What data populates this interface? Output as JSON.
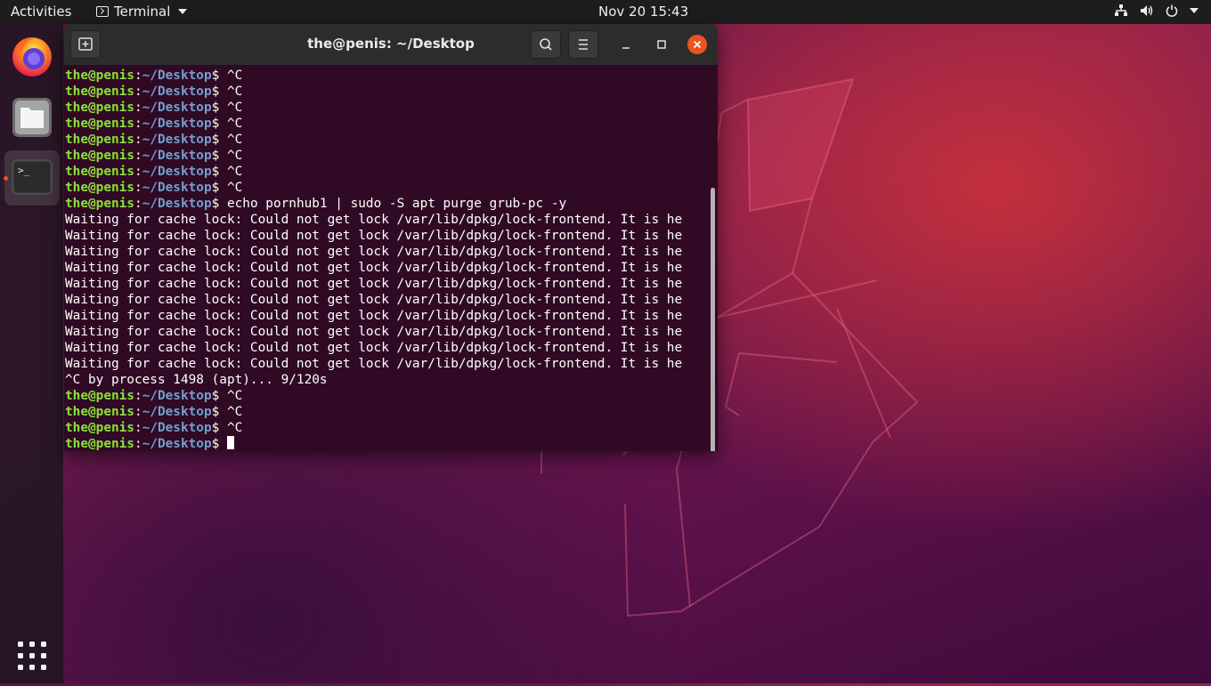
{
  "topbar": {
    "activities": "Activities",
    "app_name": "Terminal",
    "clock": "Nov 20  15:43",
    "tray_icons": [
      "network-icon",
      "volume-icon",
      "power-icon",
      "chevron-down-icon"
    ]
  },
  "dock": {
    "items": [
      {
        "name": "Firefox",
        "icon": "firefox-icon"
      },
      {
        "name": "Files",
        "icon": "files-icon"
      },
      {
        "name": "Terminal",
        "icon": "terminal-icon",
        "active": true,
        "running": true
      }
    ],
    "show_apps_icon": "grid-icon"
  },
  "window": {
    "title": "the@penis: ~/Desktop",
    "header_buttons": [
      "new-tab-icon",
      "search-icon",
      "hamburger-menu-icon",
      "minimize-icon",
      "maximize-icon",
      "close-icon"
    ]
  },
  "terminal": {
    "user_host": "the@penis",
    "path": "~/Desktop",
    "lines": [
      {
        "prompt": true,
        "cmd": "^C"
      },
      {
        "prompt": true,
        "cmd": "^C"
      },
      {
        "prompt": true,
        "cmd": "^C"
      },
      {
        "prompt": true,
        "cmd": "^C"
      },
      {
        "prompt": true,
        "cmd": "^C"
      },
      {
        "prompt": true,
        "cmd": "^C"
      },
      {
        "prompt": true,
        "cmd": "^C"
      },
      {
        "prompt": true,
        "cmd": "^C"
      },
      {
        "prompt": true,
        "cmd": "echo pornhub1 | sudo -S apt purge grub-pc -y"
      },
      {
        "prompt": false,
        "text": "Waiting for cache lock: Could not get lock /var/lib/dpkg/lock-frontend. It is he"
      },
      {
        "prompt": false,
        "text": "Waiting for cache lock: Could not get lock /var/lib/dpkg/lock-frontend. It is he"
      },
      {
        "prompt": false,
        "text": "Waiting for cache lock: Could not get lock /var/lib/dpkg/lock-frontend. It is he"
      },
      {
        "prompt": false,
        "text": "Waiting for cache lock: Could not get lock /var/lib/dpkg/lock-frontend. It is he"
      },
      {
        "prompt": false,
        "text": "Waiting for cache lock: Could not get lock /var/lib/dpkg/lock-frontend. It is he"
      },
      {
        "prompt": false,
        "text": "Waiting for cache lock: Could not get lock /var/lib/dpkg/lock-frontend. It is he"
      },
      {
        "prompt": false,
        "text": "Waiting for cache lock: Could not get lock /var/lib/dpkg/lock-frontend. It is he"
      },
      {
        "prompt": false,
        "text": "Waiting for cache lock: Could not get lock /var/lib/dpkg/lock-frontend. It is he"
      },
      {
        "prompt": false,
        "text": "Waiting for cache lock: Could not get lock /var/lib/dpkg/lock-frontend. It is he"
      },
      {
        "prompt": false,
        "text": "Waiting for cache lock: Could not get lock /var/lib/dpkg/lock-frontend. It is he"
      },
      {
        "prompt": false,
        "text": "^C by process 1498 (apt)... 9/120s"
      },
      {
        "prompt": true,
        "cmd": "^C"
      },
      {
        "prompt": true,
        "cmd": "^C"
      },
      {
        "prompt": true,
        "cmd": "^C"
      },
      {
        "prompt": true,
        "cmd": "",
        "cursor": true
      }
    ]
  },
  "colors": {
    "terminal_bg": "#300a24",
    "prompt_user": "#8ae234",
    "prompt_path": "#729fcf",
    "close_button": "#e95420",
    "topbar_bg": "#1d1d1d"
  }
}
